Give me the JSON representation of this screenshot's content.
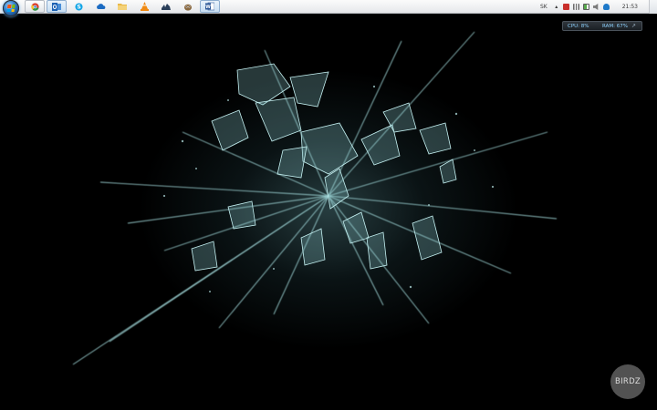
{
  "taskbar": {
    "apps": [
      {
        "name": "chrome",
        "icon": "chrome-icon",
        "color": "#d9412f"
      },
      {
        "name": "outlook",
        "icon": "outlook-icon",
        "color": "#1f63b4"
      },
      {
        "name": "skype",
        "icon": "skype-icon",
        "color": "#12a5e6"
      },
      {
        "name": "onedrive",
        "icon": "cloud-icon",
        "color": "#1c6bc2"
      },
      {
        "name": "explorer",
        "icon": "folder-icon",
        "color": "#e9b949"
      },
      {
        "name": "vlc",
        "icon": "vlc-cone-icon",
        "color": "#f08a14"
      },
      {
        "name": "steam",
        "icon": "steam-icon",
        "color": "#2a3f5a"
      },
      {
        "name": "gimp",
        "icon": "gimp-icon",
        "color": "#8a6a42"
      },
      {
        "name": "word",
        "icon": "word-icon",
        "color": "#2b5797"
      }
    ]
  },
  "tray": {
    "language": "SK",
    "clock": "21:53",
    "icons": [
      "chevron-up-icon",
      "flag-icon",
      "network-icon",
      "battery-icon",
      "volume-icon",
      "cloud-icon"
    ]
  },
  "monitor": {
    "cpu_label": "CPU: 8%",
    "ram_label": "RAM: 67%",
    "arrow": "↗"
  },
  "watermark": {
    "text": "BIRDZ"
  },
  "colors": {
    "background": "#000000",
    "glass": "#a9e3e4",
    "monitor_text": "#8fd3ff"
  }
}
